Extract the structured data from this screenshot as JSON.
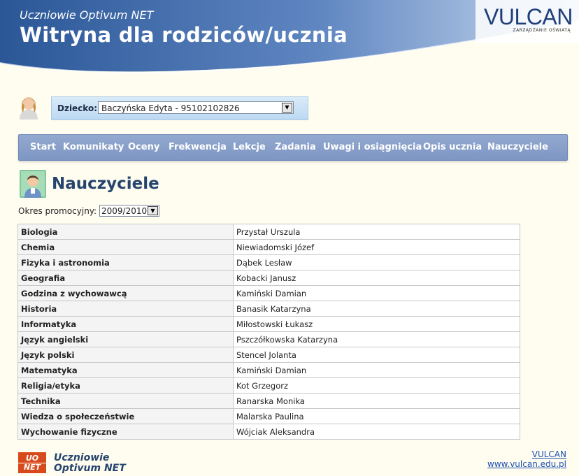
{
  "header": {
    "subtitle": "Uczniowie Optivum NET",
    "title": "Witryna dla rodziców/ucznia",
    "logo_text": "VULCAN",
    "logo_tagline": "ZARZĄDZANIE OŚWIATĄ",
    "colors": {
      "gradient_start": "#2b5797",
      "gradient_end": "#9db7de"
    }
  },
  "child_selector": {
    "label": "Dziecko:",
    "value": "Baczyńska Edyta - 95102102826"
  },
  "nav": {
    "items": [
      "Start",
      "Komunikaty",
      "Oceny",
      "Frekwencja",
      "Lekcje",
      "Zadania",
      "Uwagi i osiągnięcia",
      "Opis ucznia",
      "Nauczyciele"
    ]
  },
  "page": {
    "title": "Nauczyciele",
    "period_label": "Okres promocyjny:",
    "period_value": "2009/2010"
  },
  "teachers": [
    {
      "subject": "Biologia",
      "teacher": "Przystał Urszula"
    },
    {
      "subject": "Chemia",
      "teacher": "Niewiadomski Józef"
    },
    {
      "subject": "Fizyka i astronomia",
      "teacher": "Dąbek Lesław"
    },
    {
      "subject": "Geografia",
      "teacher": "Kobacki Janusz"
    },
    {
      "subject": "Godzina z wychowawcą",
      "teacher": "Kamiński Damian"
    },
    {
      "subject": "Historia",
      "teacher": "Banasik Katarzyna"
    },
    {
      "subject": "Informatyka",
      "teacher": "Miłostowski Łukasz"
    },
    {
      "subject": "Język angielski",
      "teacher": "Pszczółkowska Katarzyna"
    },
    {
      "subject": "Język polski",
      "teacher": "Stencel Jolanta"
    },
    {
      "subject": "Matematyka",
      "teacher": "Kamiński Damian"
    },
    {
      "subject": "Religia/etyka",
      "teacher": "Kot Grzegorz"
    },
    {
      "subject": "Technika",
      "teacher": "Ranarska Monika"
    },
    {
      "subject": "Wiedza o społeczeństwie",
      "teacher": "Malarska Paulina"
    },
    {
      "subject": "Wychowanie fizyczne",
      "teacher": "Wójciak Aleksandra"
    }
  ],
  "footer": {
    "logo_line1": "UO",
    "logo_line2": "NET",
    "brand_line1": "Uczniowie",
    "brand_line2": "Optivum NET",
    "link1": "VULCAN",
    "link2": "www.vulcan.edu.pl"
  }
}
